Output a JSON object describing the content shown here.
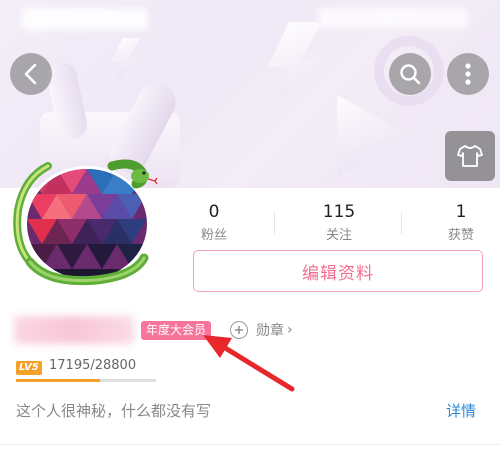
{
  "header": {
    "back_icon": "chevron-left-icon",
    "search_icon": "search-icon",
    "more_icon": "more-vertical-icon",
    "dress_icon": "tshirt-icon"
  },
  "stats": [
    {
      "value": "0",
      "label": "粉丝"
    },
    {
      "value": "115",
      "label": "关注"
    },
    {
      "value": "1",
      "label": "获赞"
    }
  ],
  "profile": {
    "edit_button": "编辑资料",
    "vip_badge": "年度大会员",
    "medal_label": "勋章",
    "medal_chevron": "›",
    "level_badge": "LV5",
    "exp_text": "17195/28800",
    "exp_progress": 0.597,
    "bio": "这个人很神秘，什么都没有写",
    "detail_link": "详情"
  },
  "colors": {
    "accent_pink": "#f16e8f",
    "vip_pink": "#f7749b",
    "level_orange": "#f5a12a",
    "link_blue": "#2b8ad6",
    "annotation_red": "#e8272b"
  }
}
